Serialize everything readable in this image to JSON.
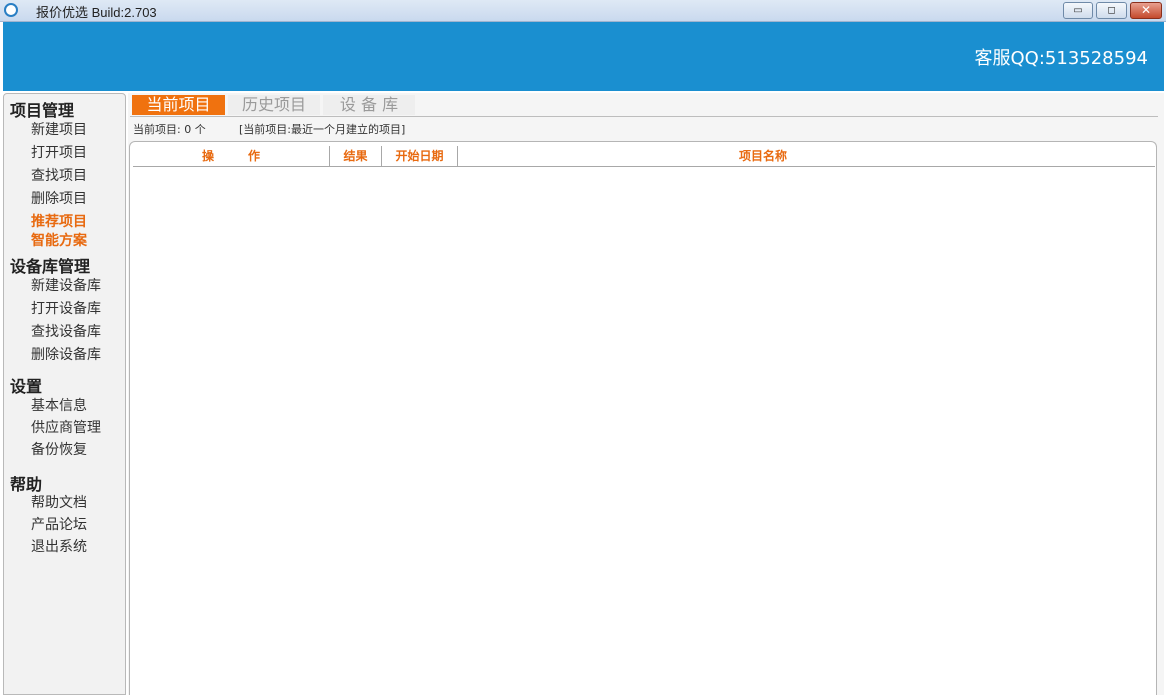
{
  "window": {
    "title": "报价优选    Build:2.703",
    "minimize_label": "▭",
    "maximize_label": "◻",
    "close_label": "✕"
  },
  "header": {
    "support": "客服QQ:513528594",
    "background": "#1a8fd0"
  },
  "sidebar": {
    "sections": [
      {
        "title": "项目管理",
        "items": [
          "新建项目",
          "打开项目",
          "查找项目",
          "删除项目"
        ],
        "highlighted": [
          "推荐项目",
          "智能方案"
        ]
      },
      {
        "title": "设备库管理",
        "items": [
          "新建设备库",
          "打开设备库",
          "查找设备库",
          "删除设备库"
        ]
      },
      {
        "title": "设置",
        "items": [
          "基本信息",
          "供应商管理",
          "备份恢复"
        ]
      },
      {
        "title": "帮助",
        "items": [
          "帮助文档",
          "产品论坛",
          "退出系统"
        ]
      }
    ]
  },
  "main": {
    "tabs": [
      {
        "label": "当前项目",
        "active": true
      },
      {
        "label": "历史项目",
        "active": false
      },
      {
        "label": "设 备 库",
        "active": false
      }
    ],
    "count_text": "当前项目: 0 个",
    "hint_text": "[当前项目:最近一个月建立的项目]",
    "table": {
      "columns": [
        "操",
        "作",
        "结果",
        "开始日期",
        "项目名称"
      ],
      "rows": []
    }
  },
  "colors": {
    "accent": "#f0720f",
    "highlight_text": "#e86a10"
  }
}
